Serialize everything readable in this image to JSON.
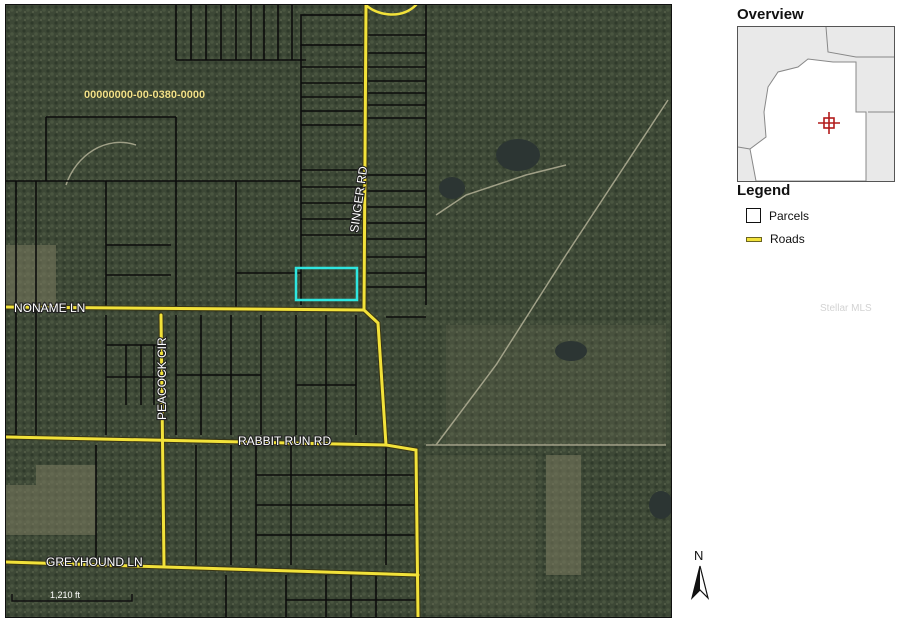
{
  "overview": {
    "title": "Overview"
  },
  "legend": {
    "title": "Legend",
    "items": [
      {
        "label": "Parcels",
        "swatch": "parcel-outline",
        "color": "#111111"
      },
      {
        "label": "Roads",
        "swatch": "road-line",
        "color": "#f2e23a"
      }
    ]
  },
  "map": {
    "parcel_id": "00000000-00-0380-0000",
    "roads": {
      "singer": "SINGER RD",
      "noname": "NONAME LN",
      "peacock": "PEACOCK CIR",
      "rabbit_run": "RABBIT RUN RD",
      "greyhound": "GREYHOUND LN"
    },
    "scale_label": "1,210 ft",
    "north_label": "N",
    "highlight_color": "#2ee6e0",
    "road_color": "#f2e23a"
  },
  "watermark": "Stellar MLS"
}
